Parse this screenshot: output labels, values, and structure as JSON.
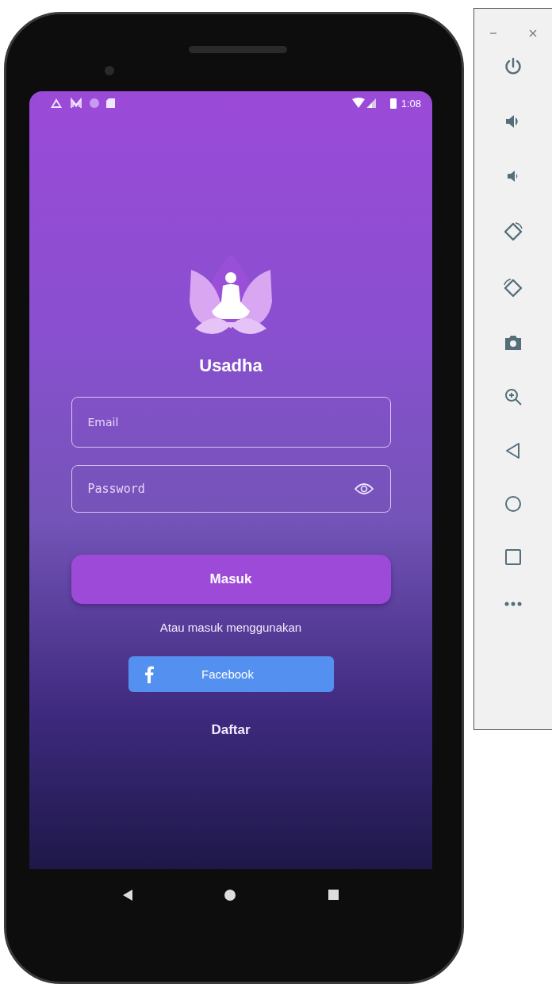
{
  "status_bar": {
    "time": "1:08"
  },
  "app": {
    "title": "Usadha",
    "fields": [
      {
        "kind": "text",
        "placeholder": "Email"
      },
      {
        "kind": "password",
        "placeholder": "Password"
      }
    ],
    "login_button": "Masuk",
    "alt_text": "Atau masuk menggunakan",
    "social_button": "Facebook",
    "register_link": "Daftar"
  }
}
